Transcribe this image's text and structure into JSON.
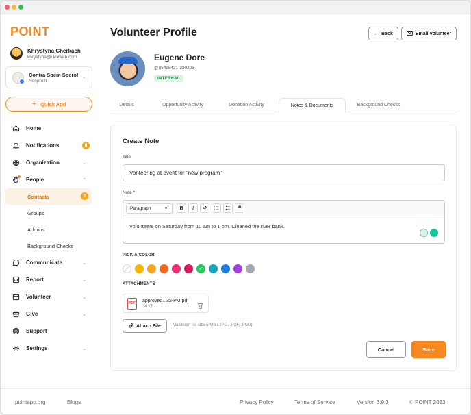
{
  "app": {
    "logo": "POINT"
  },
  "user": {
    "name": "Khrystyna Cherkach",
    "email": "khrystyna@ukieweb.com"
  },
  "org": {
    "name": "Contra Spem Spero!",
    "type": "Nonprofit"
  },
  "quick_add": {
    "label": "Quick Add",
    "icon": "plus-icon"
  },
  "nav": {
    "home": "Home",
    "notifications": "Notifications",
    "notifications_count": "8",
    "organization": "Organization",
    "people": "People",
    "contacts": "Contacts",
    "contacts_count": "2",
    "groups": "Groups",
    "admins": "Admins",
    "background_checks": "Background Checks",
    "communicate": "Communicate",
    "report": "Report",
    "volunteer": "Volunteer",
    "give": "Give",
    "support": "Support",
    "settings": "Settings"
  },
  "header": {
    "title": "Volunteer Profile",
    "back_label": "Back",
    "email_label": "Email Volunteer"
  },
  "profile": {
    "name": "Eugene Dore",
    "id": "@854c5421-230203",
    "tag": "INTERNAL"
  },
  "tabs": [
    "Details",
    "Opportunity Activity",
    "Donation Activity",
    "Notes & Documents",
    "Background Checks"
  ],
  "note": {
    "heading": "Create Note",
    "title_label": "Title",
    "title_value": "Vonteering at event for \"new program\"",
    "note_label": "Note *",
    "format_select": "Paragraph",
    "note_text": "Volunteers on Saturday from 10 am to 1 pm. Cleaned the river bank.",
    "color_label": "PICK A COLOR",
    "colors": [
      "none",
      "#f5b800",
      "#f5a623",
      "#f26b1d",
      "#ef2d6f",
      "#d81b60",
      "#22c55e",
      "#17a5c6",
      "#1d7fe0",
      "#a13fe0",
      "#a3a9b3"
    ],
    "selected_color_index": 6,
    "attachments_label": "ATTACHMENTS",
    "file_name": "approved...32-PM.pdf",
    "file_size": "34 KB",
    "file_type": "PDF",
    "attach_label": "Attach File",
    "hint": "Maximum file size 5 MB (.JPG, .PDF, .PNG)",
    "cancel_label": "Cancel",
    "save_label": "Save"
  },
  "footer": {
    "site": "pointapp.org",
    "blogs": "Blogs",
    "privacy": "Privacy Policy",
    "terms": "Terms of Service",
    "version": "Version 3.9.3",
    "copyright": "© POINT 2023"
  },
  "theme": {
    "accent": "#f5891f",
    "success": "#1f9a4b"
  }
}
